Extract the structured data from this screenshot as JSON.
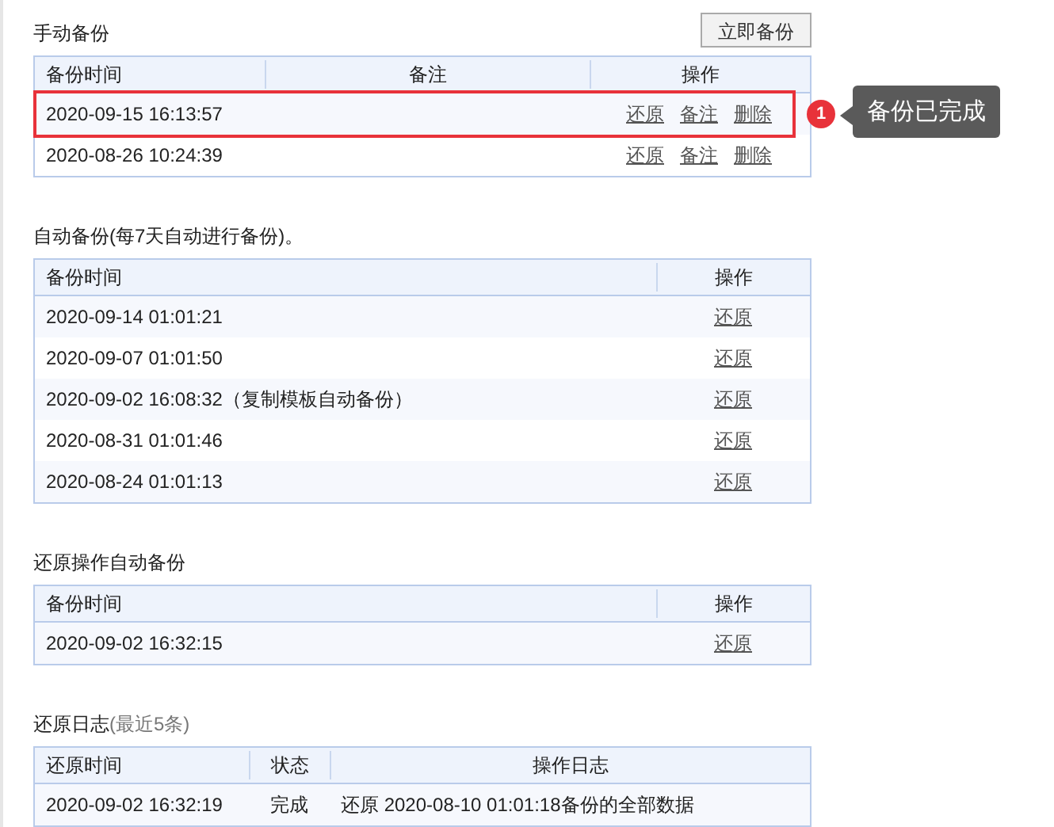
{
  "sections": [
    {
      "title": "手动备份",
      "button": "立即备份",
      "columns": [
        {
          "label": "备份时间",
          "kind": "time"
        },
        {
          "label": "备注",
          "kind": "note"
        },
        {
          "label": "操作",
          "kind": "actions"
        }
      ],
      "rows": [
        {
          "time": "2020-09-15 16:13:57",
          "actions": [
            "还原",
            "备注",
            "删除"
          ],
          "highlighted": true,
          "callout": {
            "number": "1",
            "text": "备份已完成"
          }
        },
        {
          "time": "2020-08-26 10:24:39",
          "actions": [
            "还原",
            "备注",
            "删除"
          ],
          "highlighted": false
        }
      ]
    },
    {
      "title": "自动备份(每7天自动进行备份)。",
      "columns": [
        {
          "label": "备份时间",
          "kind": "time"
        },
        {
          "label": "操作",
          "kind": "actions"
        }
      ],
      "rows": [
        {
          "time": "2020-09-14 01:01:21",
          "actions": [
            "还原"
          ]
        },
        {
          "time": "2020-09-07 01:01:50",
          "actions": [
            "还原"
          ]
        },
        {
          "time": "2020-09-02 16:08:32（复制模板自动备份）",
          "actions": [
            "还原"
          ]
        },
        {
          "time": "2020-08-31 01:01:46",
          "actions": [
            "还原"
          ]
        },
        {
          "time": "2020-08-24 01:01:13",
          "actions": [
            "还原"
          ]
        }
      ]
    },
    {
      "title": "还原操作自动备份",
      "columns": [
        {
          "label": "备份时间",
          "kind": "time"
        },
        {
          "label": "操作",
          "kind": "actions"
        }
      ],
      "rows": [
        {
          "time": "2020-09-02 16:32:15",
          "actions": [
            "还原"
          ]
        }
      ]
    },
    {
      "title": "还原日志",
      "note": "(最近5条)",
      "columns": [
        {
          "label": "还原时间",
          "kind": "time"
        },
        {
          "label": "状态",
          "kind": "status"
        },
        {
          "label": "操作日志",
          "kind": "log"
        }
      ],
      "rows": [
        {
          "time": "2020-09-02 16:32:19",
          "status": "完成",
          "log": "还原 2020-08-10 01:01:18备份的全部数据"
        }
      ]
    }
  ]
}
